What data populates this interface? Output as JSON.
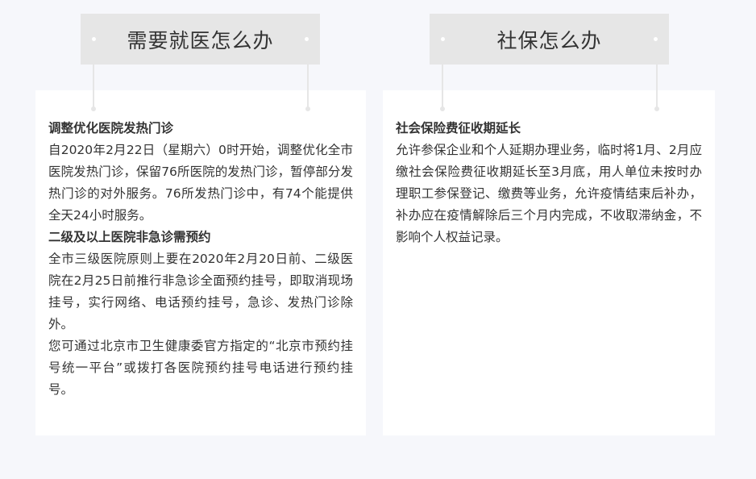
{
  "left_panel": {
    "title": "需要就医怎么办",
    "sections": [
      {
        "heading": "调整优化医院发热门诊",
        "paragraphs": [
          "自2020年2月22日（星期六）0时开始，调整优化全市医院发热门诊，保留76所医院的发热门诊，暂停部分发热门诊的对外服务。76所发热门诊中，有74个能提供全天24小时服务。"
        ]
      },
      {
        "heading": "二级及以上医院非急诊需预约",
        "paragraphs": [
          "全市三级医院原则上要在2020年2月20日前、二级医院在2月25日前推行非急诊全面预约挂号，即取消现场挂号，实行网络、电话预约挂号，急诊、发热门诊除外。",
          "您可通过北京市卫生健康委官方指定的“北京市预约挂号统一平台”或拨打各医院预约挂号电话进行预约挂号。"
        ]
      }
    ]
  },
  "right_panel": {
    "title": "社保怎么办",
    "sections": [
      {
        "heading": "社会保险费征收期延长",
        "paragraphs": [
          "允许参保企业和个人延期办理业务，临时将1月、2月应缴社会保险费征收期延长至3月底，用人单位未按时办理职工参保登记、缴费等业务，允许疫情结束后补办，补办应在疫情解除后三个月内完成，不收取滞纳金，不影响个人权益记录。"
        ]
      }
    ]
  },
  "colors": {
    "page_background": "#f6f7fb",
    "card_background": "#ffffff",
    "title_box_background": "#e6e6e6",
    "text": "#333333"
  }
}
